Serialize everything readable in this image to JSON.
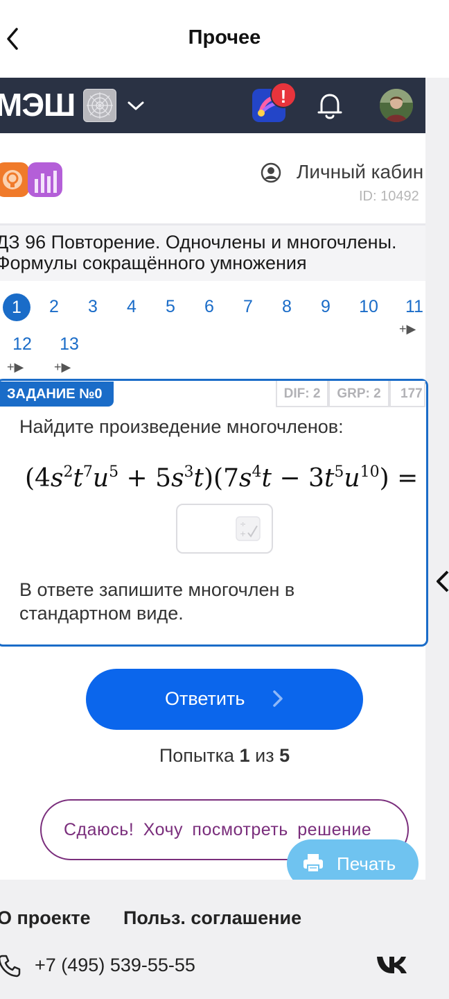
{
  "topbar": {
    "title": "Прочее"
  },
  "header": {
    "logo_text": "МЭШ",
    "badge": "!"
  },
  "cabinet": {
    "label": "Личный кабин",
    "user_id": "ID: 10492"
  },
  "homework": {
    "title_line1": "ДЗ 96 Повторение. Одночлены и многочлены.",
    "title_line2": "Формулы сокращённого умножения"
  },
  "tasks": {
    "items": [
      "1",
      "2",
      "3",
      "4",
      "5",
      "6",
      "7",
      "8",
      "9",
      "10",
      "11",
      "12",
      "13"
    ],
    "active": "1",
    "video_marker": "+▶"
  },
  "card": {
    "label": "ЗАДАНИЕ №0",
    "tags": [
      "DIF: 2",
      "GRP: 2",
      "177"
    ],
    "prompt": "Найдите произведение многочленов:",
    "formula": "(4s^2t^7u^5 + 5s^3t)(7s^4t − 3t^5u^10) =",
    "hint": "В ответе запишите многочлен в стандартном виде."
  },
  "actions": {
    "answer_label": "Ответить",
    "attempt_prefix": "Попытка",
    "attempt_current": "1",
    "attempt_sep": "из",
    "attempt_total": "5",
    "giveup_label": "Сдаюсь! Хочу посмотреть решение",
    "print_label": "Печать"
  },
  "footer": {
    "about": "О проекте",
    "agreement": "Польз. соглашение",
    "phone": "+7 (495) 539-55-55"
  },
  "colors": {
    "accent": "#0b66ec",
    "header_bg": "#2a3244",
    "giveup": "#7a2e7c",
    "print": "#6fc3f0"
  }
}
